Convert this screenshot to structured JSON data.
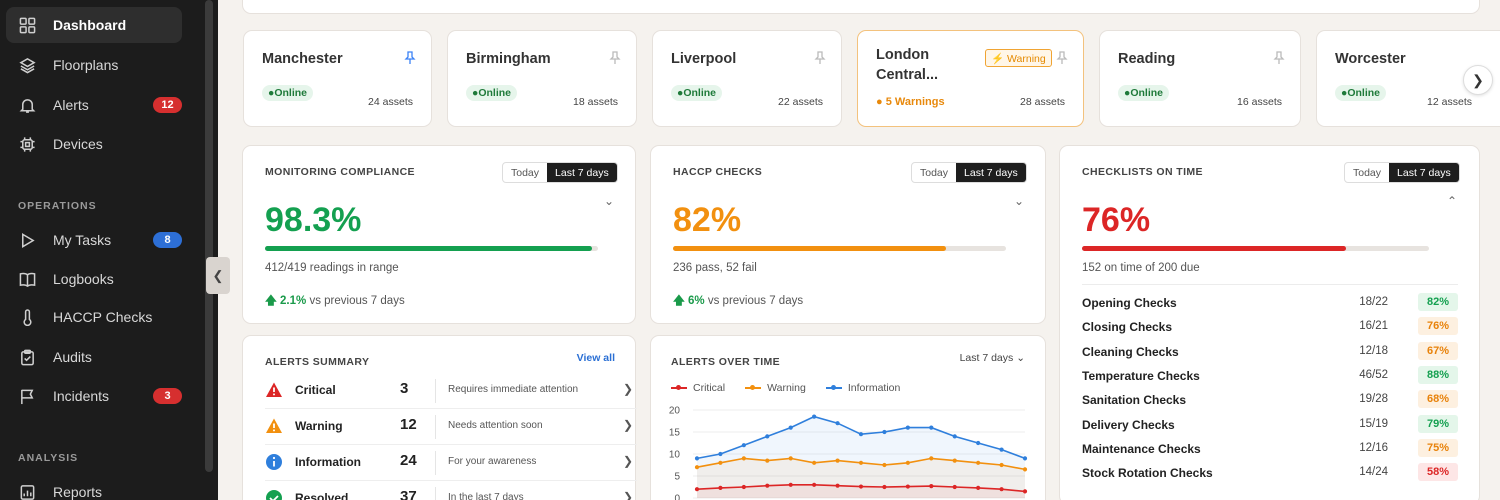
{
  "sidebar": {
    "items": [
      {
        "label": "Dashboard",
        "icon": "grid-icon"
      },
      {
        "label": "Floorplans",
        "icon": "layers-icon"
      },
      {
        "label": "Alerts",
        "icon": "bell-icon",
        "badge": "12"
      },
      {
        "label": "Devices",
        "icon": "device-icon"
      }
    ],
    "operations_title": "OPERATIONS",
    "operations": [
      {
        "label": "My Tasks",
        "icon": "play-icon",
        "badge": "8"
      },
      {
        "label": "Logbooks",
        "icon": "book-icon"
      },
      {
        "label": "HACCP Checks",
        "icon": "thermometer-icon"
      },
      {
        "label": "Audits",
        "icon": "clipboard-icon"
      },
      {
        "label": "Incidents",
        "icon": "flag-icon",
        "badge": "3"
      }
    ],
    "analysis_title": "ANALYSIS",
    "analysis": [
      {
        "label": "Reports",
        "icon": "report-icon"
      }
    ]
  },
  "colors": {
    "green": "#14a050",
    "orange": "#f2900f",
    "red": "#dc2626",
    "blue": "#2f7fdc",
    "badge_red": "#d62f2f",
    "badge_blue": "#2d6fd6"
  },
  "sites": [
    {
      "name": "Manchester",
      "status": "Online",
      "assets": "24 assets",
      "pin_color": "#3b82f6"
    },
    {
      "name": "Birmingham",
      "status": "Online",
      "assets": "18 assets",
      "pin_color": "#bbbbbb"
    },
    {
      "name": "Liverpool",
      "status": "Online",
      "assets": "22 assets",
      "pin_color": "#bbbbbb"
    },
    {
      "name": "London Central...",
      "badge": "⚡ Warning",
      "warnings": "5 Warnings",
      "assets": "28 assets",
      "pin_color": "#bbbbbb"
    },
    {
      "name": "Reading",
      "status": "Online",
      "assets": "16 assets",
      "pin_color": "#bbbbbb"
    },
    {
      "name": "Worcester",
      "status": "Online",
      "assets": "12 assets",
      "pin_color": "#bbbbbb"
    }
  ],
  "toggle": {
    "today": "Today",
    "last7": "Last 7 days"
  },
  "kpis": [
    {
      "title": "MONITORING COMPLIANCE",
      "value": "98.3%",
      "progress": 0.983,
      "color": "#14a050",
      "sub": "412/419 readings in range",
      "trend": "2.1%",
      "trend_text": "vs previous 7 days"
    },
    {
      "title": "HACCP CHECKS",
      "value": "82%",
      "progress": 0.82,
      "color": "#f2900f",
      "sub": "236 pass, 52 fail",
      "trend": "6%",
      "trend_text": "vs previous 7 days"
    },
    {
      "title": "CHECKLISTS ON TIME",
      "value": "76%",
      "progress": 0.76,
      "color": "#dc2626",
      "sub": "152 on time of 200 due"
    }
  ],
  "checklists": [
    {
      "name": "Opening Checks",
      "count": "18/22",
      "pct": "82%",
      "tone": "green"
    },
    {
      "name": "Closing Checks",
      "count": "16/21",
      "pct": "76%",
      "tone": "orange"
    },
    {
      "name": "Cleaning Checks",
      "count": "12/18",
      "pct": "67%",
      "tone": "orange"
    },
    {
      "name": "Temperature Checks",
      "count": "46/52",
      "pct": "88%",
      "tone": "green"
    },
    {
      "name": "Sanitation Checks",
      "count": "19/28",
      "pct": "68%",
      "tone": "orange"
    },
    {
      "name": "Delivery Checks",
      "count": "15/19",
      "pct": "79%",
      "tone": "green"
    },
    {
      "name": "Maintenance Checks",
      "count": "12/16",
      "pct": "75%",
      "tone": "orange"
    },
    {
      "name": "Stock Rotation Checks",
      "count": "14/24",
      "pct": "58%",
      "tone": "red"
    }
  ],
  "alerts_summary": {
    "title": "ALERTS SUMMARY",
    "view_all": "View all",
    "rows": [
      {
        "name": "Critical",
        "count": "3",
        "desc": "Requires immediate attention",
        "icon": "critical-triangle-icon"
      },
      {
        "name": "Warning",
        "count": "12",
        "desc": "Needs attention soon",
        "icon": "warning-triangle-icon"
      },
      {
        "name": "Information",
        "count": "24",
        "desc": "For your awareness",
        "icon": "info-circle-icon"
      },
      {
        "name": "Resolved",
        "count": "37",
        "desc": "In the last 7 days",
        "icon": "check-circle-icon"
      }
    ]
  },
  "alerts_over_time": {
    "title": "ALERTS OVER TIME",
    "range": "Last 7 days"
  },
  "chart_data": {
    "type": "line",
    "x": [
      1,
      2,
      3,
      4,
      5,
      6,
      7,
      8,
      9,
      10,
      11,
      12,
      13,
      14,
      15
    ],
    "series": [
      {
        "name": "Critical",
        "color": "#dc2626",
        "values": [
          2,
          2.3,
          2.5,
          2.8,
          3,
          3,
          2.8,
          2.6,
          2.5,
          2.6,
          2.7,
          2.5,
          2.3,
          2,
          1.5
        ]
      },
      {
        "name": "Warning",
        "color": "#f2900f",
        "values": [
          7,
          8,
          9,
          8.5,
          9,
          8,
          8.5,
          8,
          7.5,
          8,
          9,
          8.5,
          8,
          7.5,
          6.5
        ]
      },
      {
        "name": "Information",
        "color": "#2f7fdc",
        "values": [
          9,
          10,
          12,
          14,
          16,
          18.5,
          17,
          14.5,
          15,
          16,
          16,
          14,
          12.5,
          11,
          9
        ]
      }
    ],
    "yticks": [
      0,
      5,
      10,
      15,
      20
    ],
    "ylim": [
      0,
      20
    ],
    "grid": true,
    "legend": "top-left"
  }
}
